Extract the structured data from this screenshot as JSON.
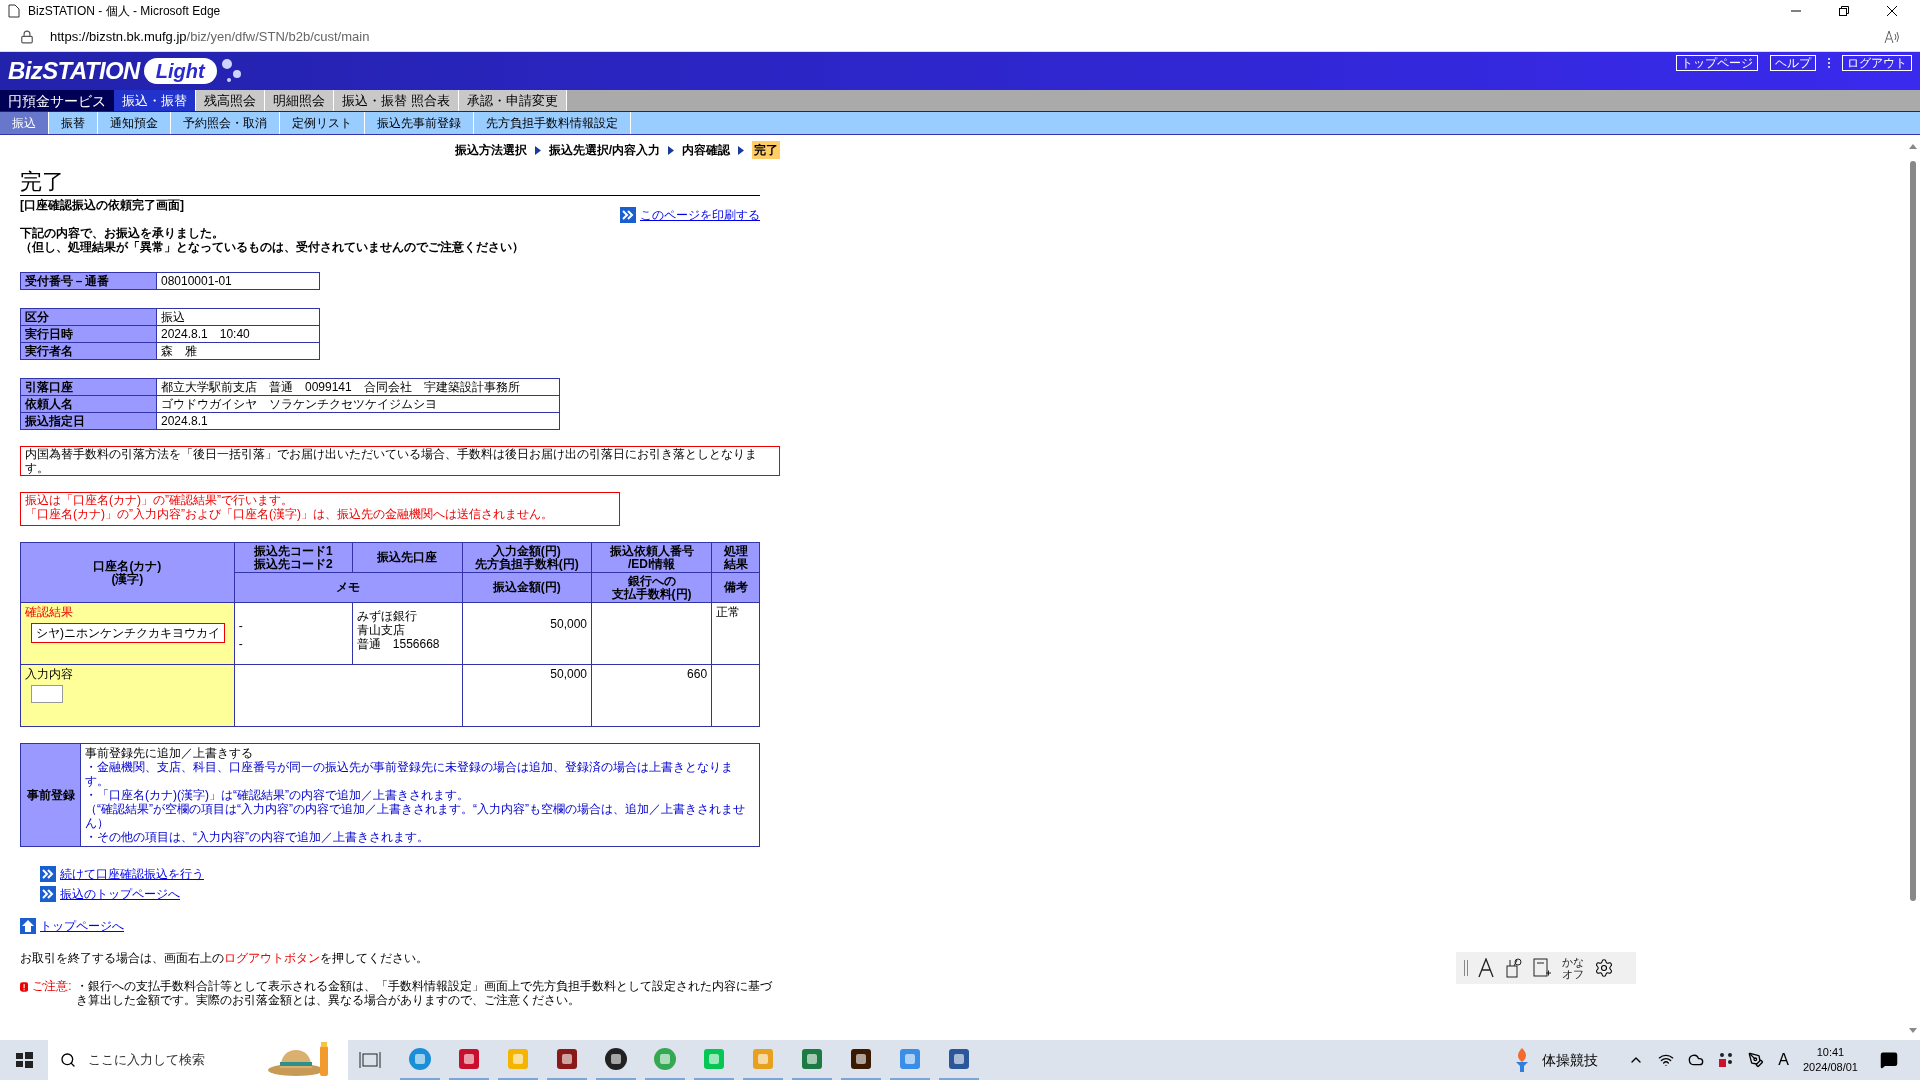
{
  "browser": {
    "title": "BizSTATION - 個人 - Microsoft Edge",
    "url_host": "https://bizstn.bk.mufg.jp",
    "url_path": "/biz/yen/dfw/STN/b2b/cust/main"
  },
  "header": {
    "logo_main": "BizSTATION",
    "logo_sub": "Light",
    "buttons": [
      "トップページ",
      "ヘルプ",
      "ログアウト"
    ]
  },
  "menu": {
    "label": "円預金サービス",
    "tabs": [
      {
        "label": "振込・振替",
        "selected": true
      },
      {
        "label": "残高照会",
        "selected": false
      },
      {
        "label": "明細照会",
        "selected": false
      },
      {
        "label": "振込・振替 照合表",
        "selected": false
      },
      {
        "label": "承認・申請変更",
        "selected": false
      }
    ]
  },
  "submenu": [
    {
      "label": "振込",
      "selected": true
    },
    {
      "label": "振替",
      "selected": false
    },
    {
      "label": "通知預金",
      "selected": false
    },
    {
      "label": "予約照会・取消",
      "selected": false
    },
    {
      "label": "定例リスト",
      "selected": false
    },
    {
      "label": "振込先事前登録",
      "selected": false
    },
    {
      "label": "先方負担手数料情報設定",
      "selected": false
    }
  ],
  "steps": [
    {
      "label": "振込方法選択",
      "selected": false
    },
    {
      "label": "振込先選択/内容入力",
      "selected": false
    },
    {
      "label": "内容確認",
      "selected": false
    },
    {
      "label": "完了",
      "selected": true
    }
  ],
  "page": {
    "title": "完了",
    "subtitle": "[口座確認振込の依頼完了画面]",
    "print_link": "このページを印刷する",
    "message": [
      "下記の内容で、お振込を承りました。",
      "（但し、処理結果が「異常」となっているものは、受付されていませんのでご注意ください）"
    ]
  },
  "info_tables": [
    [
      {
        "label": "受付番号－通番",
        "value": "08010001-01"
      }
    ],
    [
      {
        "label": "区分",
        "value": "振込"
      },
      {
        "label": "実行日時",
        "value": "2024.8.1　10:40"
      },
      {
        "label": "実行者名",
        "value": "森　雅"
      }
    ],
    [
      {
        "label": "引落口座",
        "value": "都立大学駅前支店　普通　0099141　合同会社　宇建築設計事務所"
      },
      {
        "label": "依頼人名",
        "value": "ゴウドウガイシヤ　ソラケンチクセツケイジムシヨ"
      },
      {
        "label": "振込指定日",
        "value": "2024.8.1"
      }
    ]
  ],
  "notices": [
    {
      "kind": "plain",
      "lines": [
        "内国為替手数料の引落方法を「後日一括引落」でお届け出いただいている場合、手数料は後日お届け出の引落日にお引き落としとなります。"
      ]
    },
    {
      "kind": "warning",
      "lines": [
        "振込は「口座名(カナ)」の”確認結果”で行います。",
        "「口座名(カナ)」の”入力内容”および「口座名(漢字)」は、振込先の金融機関へは送信されません。"
      ]
    }
  ],
  "transfer_table": {
    "header_top": [
      [
        "口座名(カナ)",
        "(漢字)"
      ],
      [
        "振込先コード1",
        "振込先コード2"
      ],
      [
        "振込先口座"
      ],
      [
        "入力金額(円)",
        "先方負担手数料(円)"
      ],
      [
        "振込依頼人番号",
        "/EDI情報"
      ],
      [
        "処理",
        "結果"
      ]
    ],
    "header_bottom": [
      [
        "メモ"
      ],
      [
        "振込金額(円)"
      ],
      [
        "銀行への",
        "支払手数料(円)"
      ],
      [
        "備考"
      ]
    ],
    "confirm_row": {
      "label": "確認結果",
      "kana": "シヤ)ニホンケンチクカキヨウカイ",
      "codes": [
        "-",
        "-"
      ],
      "account": [
        "みずほ銀行",
        "青山支店",
        "普通　1556668"
      ],
      "amount": "50,000",
      "result": "正常"
    },
    "input_row": {
      "label": "入力内容",
      "amount": "50,000",
      "fee": "660"
    }
  },
  "preregistration": {
    "label": "事前登録",
    "heading": "事前登録先に追加／上書きする",
    "lines": [
      "・金融機関、支店、科目、口座番号が同一の振込先が事前登録先に未登録の場合は追加、登録済の場合は上書きとなります。",
      "・「口座名(カナ)(漢字)」は“確認結果”の内容で追加／上書きされます。",
      "（“確認結果”が空欄の項目は“入力内容”の内容で追加／上書きされます。“入力内容”も空欄の場合は、追加／上書きされません）",
      "・その他の項目は、“入力内容”の内容で追加／上書きされます。"
    ]
  },
  "links": [
    "続けて口座確認振込を行う",
    "振込のトップページへ"
  ],
  "top_link": "トップページへ",
  "logout_message": {
    "before": "お取引を終了する場合は、画面右上の",
    "highlight": "ログアウトボタン",
    "after": "を押してください。"
  },
  "caution": {
    "label": "ご注意:",
    "text": "・銀行への支払手数料合計等として表示される金額は、「手数料情報設定」画面上で先方負担手数料として設定された内容に基づき算出した金額です。実際のお引落金額とは、異なる場合がありますので、ご注意ください。"
  },
  "ime_toolbar": {
    "kana_lines": [
      "かな",
      "オフ"
    ]
  },
  "taskbar": {
    "search_placeholder": "ここに入力して検索",
    "weather": "体操競技",
    "ime": "A",
    "time": "10:41",
    "date": "2024/08/01"
  }
}
